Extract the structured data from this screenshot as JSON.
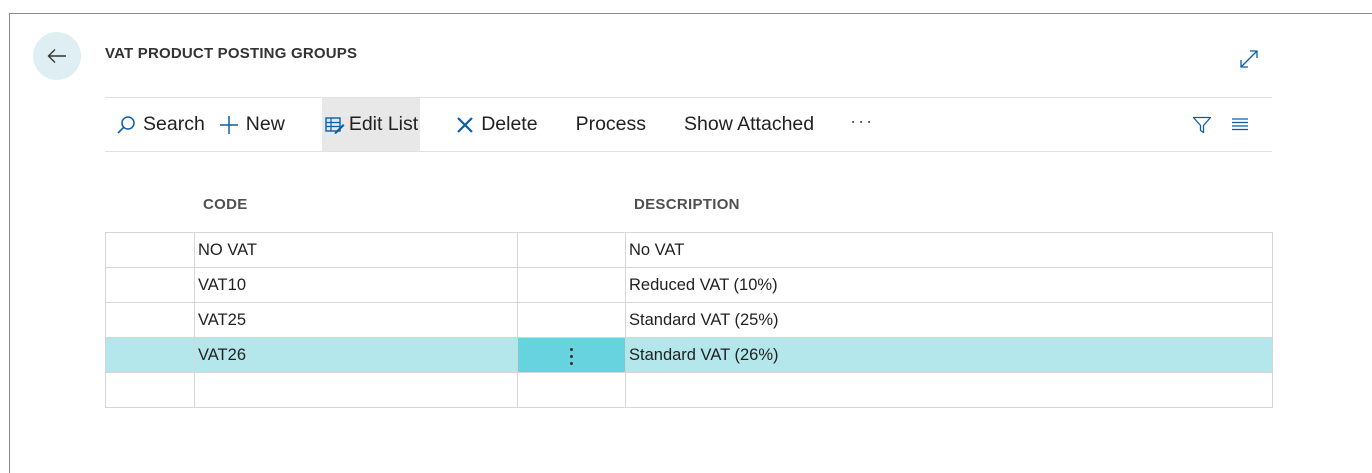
{
  "page": {
    "title": "VAT PRODUCT POSTING GROUPS"
  },
  "icons": {
    "back": "arrow-left-icon",
    "expand": "expand-diagonal-icon",
    "search": "search-icon",
    "new": "plus-icon",
    "edit_list": "edit-list-icon",
    "delete": "x-icon",
    "filter": "filter-icon",
    "list_view": "list-view-icon",
    "more": "ellipsis-icon",
    "row_actions": "vertical-ellipsis-icon"
  },
  "toolbar": {
    "search_label": "Search",
    "new_label": "New",
    "edit_list_label": "Edit List",
    "delete_label": "Delete",
    "process_label": "Process",
    "show_attached_label": "Show Attached",
    "more_label": "···"
  },
  "table": {
    "columns": [
      "CODE",
      "DESCRIPTION"
    ],
    "rows": [
      {
        "code": "NO VAT",
        "description": "No VAT"
      },
      {
        "code": "VAT10",
        "description": "Reduced VAT (10%)"
      },
      {
        "code": "VAT25",
        "description": "Standard VAT (25%)"
      },
      {
        "code": "VAT26",
        "description": "Standard VAT (26%)"
      },
      {
        "code": "",
        "description": ""
      }
    ],
    "selected_row": 3
  },
  "colors": {
    "selected_row": "#b3e7ec",
    "selected_actions_cell": "#66d3de",
    "accent": "#0b5ea8",
    "delete_icon": "#0b5ea8",
    "back_button_bg": "#dfeef3"
  }
}
